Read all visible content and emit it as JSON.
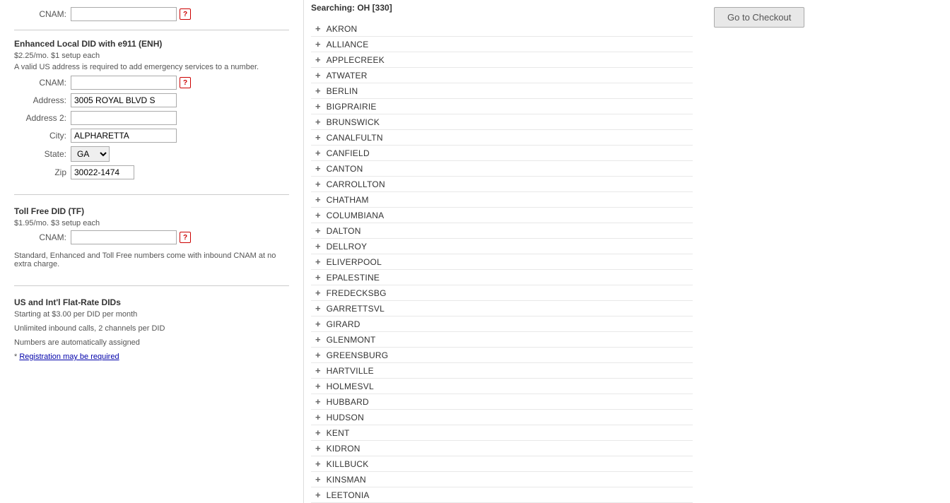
{
  "left": {
    "cnam_label": "CNAM:",
    "enhanced_section": {
      "title": "Enhanced Local DID with e911 (ENH)",
      "price": "$2.25/mo. $1 setup each",
      "note": "A valid US address is required to add emergency services to a number.",
      "cnam_label": "CNAM:",
      "address_label": "Address:",
      "address2_label": "Address 2:",
      "city_label": "City:",
      "state_label": "State:",
      "zip_label": "Zip",
      "address_value": "3005 ROYAL BLVD S",
      "city_value": "ALPHARETTA",
      "state_value": "GA",
      "zip_value": "30022-1474"
    },
    "tollfree_section": {
      "title": "Toll Free DID (TF)",
      "price": "$1.95/mo. $3 setup each",
      "cnam_label": "CNAM:",
      "note": "Standard, Enhanced and Toll Free numbers come with inbound CNAM at no extra charge."
    },
    "flatrate_section": {
      "title": "US and Int'l Flat-Rate DIDs",
      "line1": "Starting at $3.00 per DID per month",
      "line2": "Unlimited inbound calls, 2 channels per DID",
      "line3": "Numbers are automatically assigned",
      "link_prefix": "* ",
      "link_text": "Registration may be required"
    }
  },
  "middle": {
    "search_header": "Searching: OH [330]",
    "cities": [
      "AKRON",
      "ALLIANCE",
      "APPLECREEK",
      "ATWATER",
      "BERLIN",
      "BIGPRAIRIE",
      "BRUNSWICK",
      "CANALFULTN",
      "CANFIELD",
      "CANTON",
      "CARROLLTON",
      "CHATHAM",
      "COLUMBIANA",
      "DALTON",
      "DELLROY",
      "ELIVERPOOL",
      "EPALESTINE",
      "FREDECKSBG",
      "GARRETTSVL",
      "GIRARD",
      "GLENMONT",
      "GREENSBURG",
      "HARTVILLE",
      "HOLMESVL",
      "HUBBARD",
      "HUDSON",
      "KENT",
      "KIDRON",
      "KILLBUCK",
      "KINSMAN",
      "LEETONIA"
    ]
  },
  "right": {
    "checkout_label": "Go to Checkout"
  }
}
